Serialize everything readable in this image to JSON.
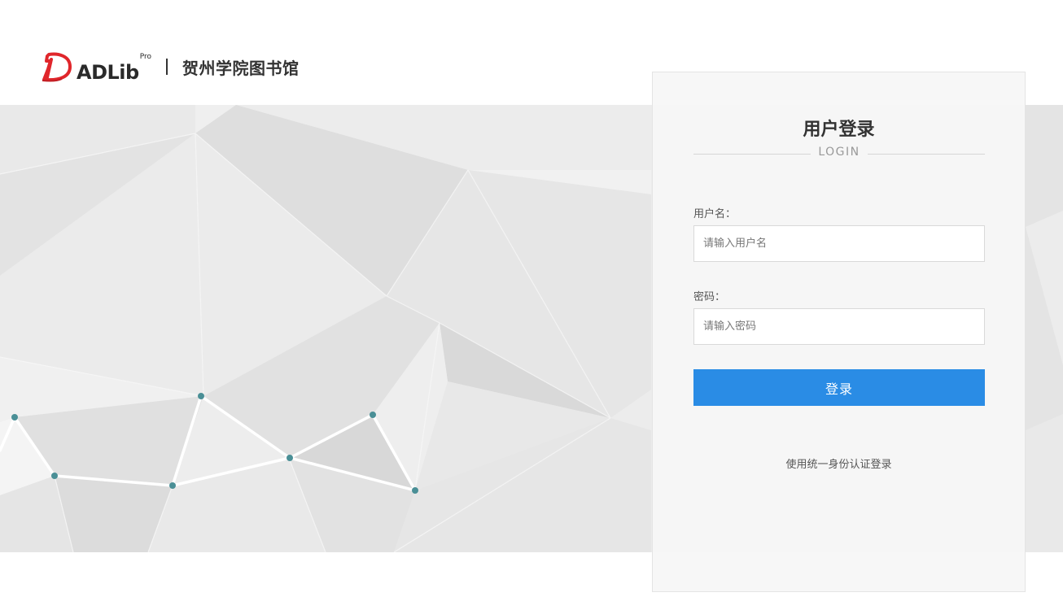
{
  "header": {
    "logo_text": "ADLib",
    "logo_sup": "Pro",
    "library_name": "贺州学院图书馆"
  },
  "login": {
    "title": "用户登录",
    "subtitle": "LOGIN",
    "username_label": "用户名：",
    "username_placeholder": "请输入用户名",
    "username_value": "",
    "password_label": "密码：",
    "password_placeholder": "请输入密码",
    "password_value": "",
    "submit_label": "登录",
    "sso_link": "使用统一身份认证登录"
  },
  "colors": {
    "accent": "#2a8ce5",
    "logo_red": "#e0262b",
    "node_teal": "#4a8f96"
  },
  "icons": {
    "logo": "adlib-d-logo-icon"
  }
}
